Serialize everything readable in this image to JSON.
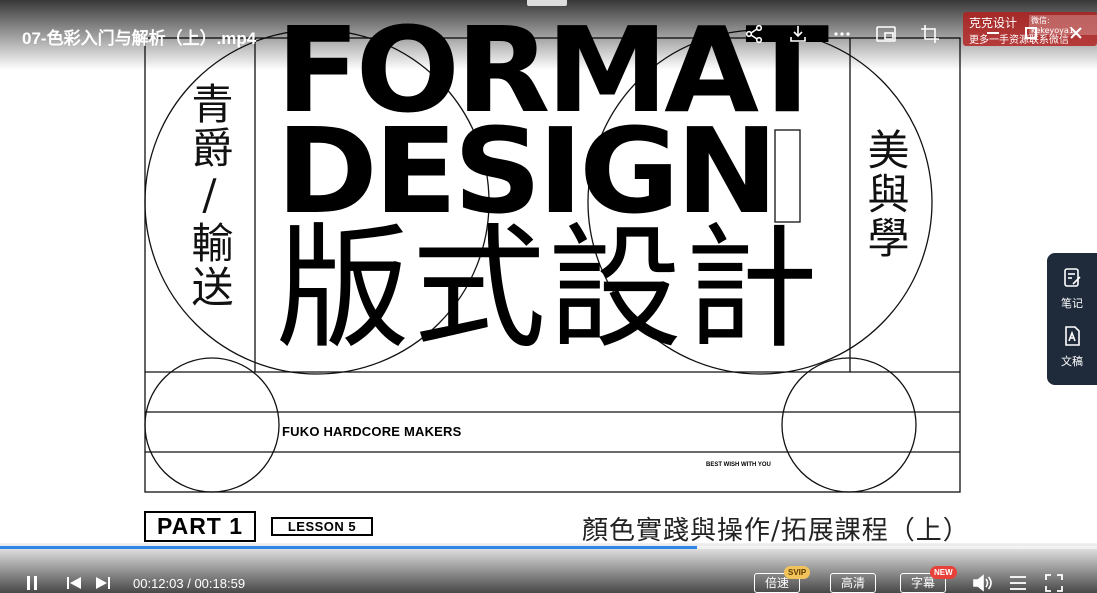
{
  "video": {
    "title": "07-色彩入门与解析（上）.mp4"
  },
  "slide": {
    "title_line1": "FORMAT",
    "title_line2": "DESIGN",
    "kanji": "版式設計",
    "left_vertical": "青爵/輸送",
    "right_vertical": "美與學",
    "maker": "FUKO HARDCORE MAKERS",
    "best_wish": "BEST WISH WITH YOU",
    "part_label": "PART 1",
    "lesson_label": "LESSON 5",
    "subtitle": "顏色實踐與操作/拓展課程（上）"
  },
  "watermark": {
    "title": "克克设计",
    "contact": "微信: kekeyoya1",
    "more": "更多一手资源联系微信"
  },
  "side_panel": {
    "notes_label": "笔记",
    "doc_label": "文稿"
  },
  "player": {
    "current_time": "00:12:03",
    "duration": "00:18:59",
    "time_display": "00:12:03 / 00:18:59",
    "progress": 0.635,
    "speed_label": "倍速",
    "speed_badge": "SVIP",
    "quality_label": "高清",
    "subtitle_label": "字幕",
    "subtitle_badge": "NEW"
  },
  "colors": {
    "progress_fill": "#2f86e8",
    "side_panel_bg": "#1f2a3a",
    "svip_badge": "#f3c35b",
    "new_badge": "#e8413a"
  }
}
